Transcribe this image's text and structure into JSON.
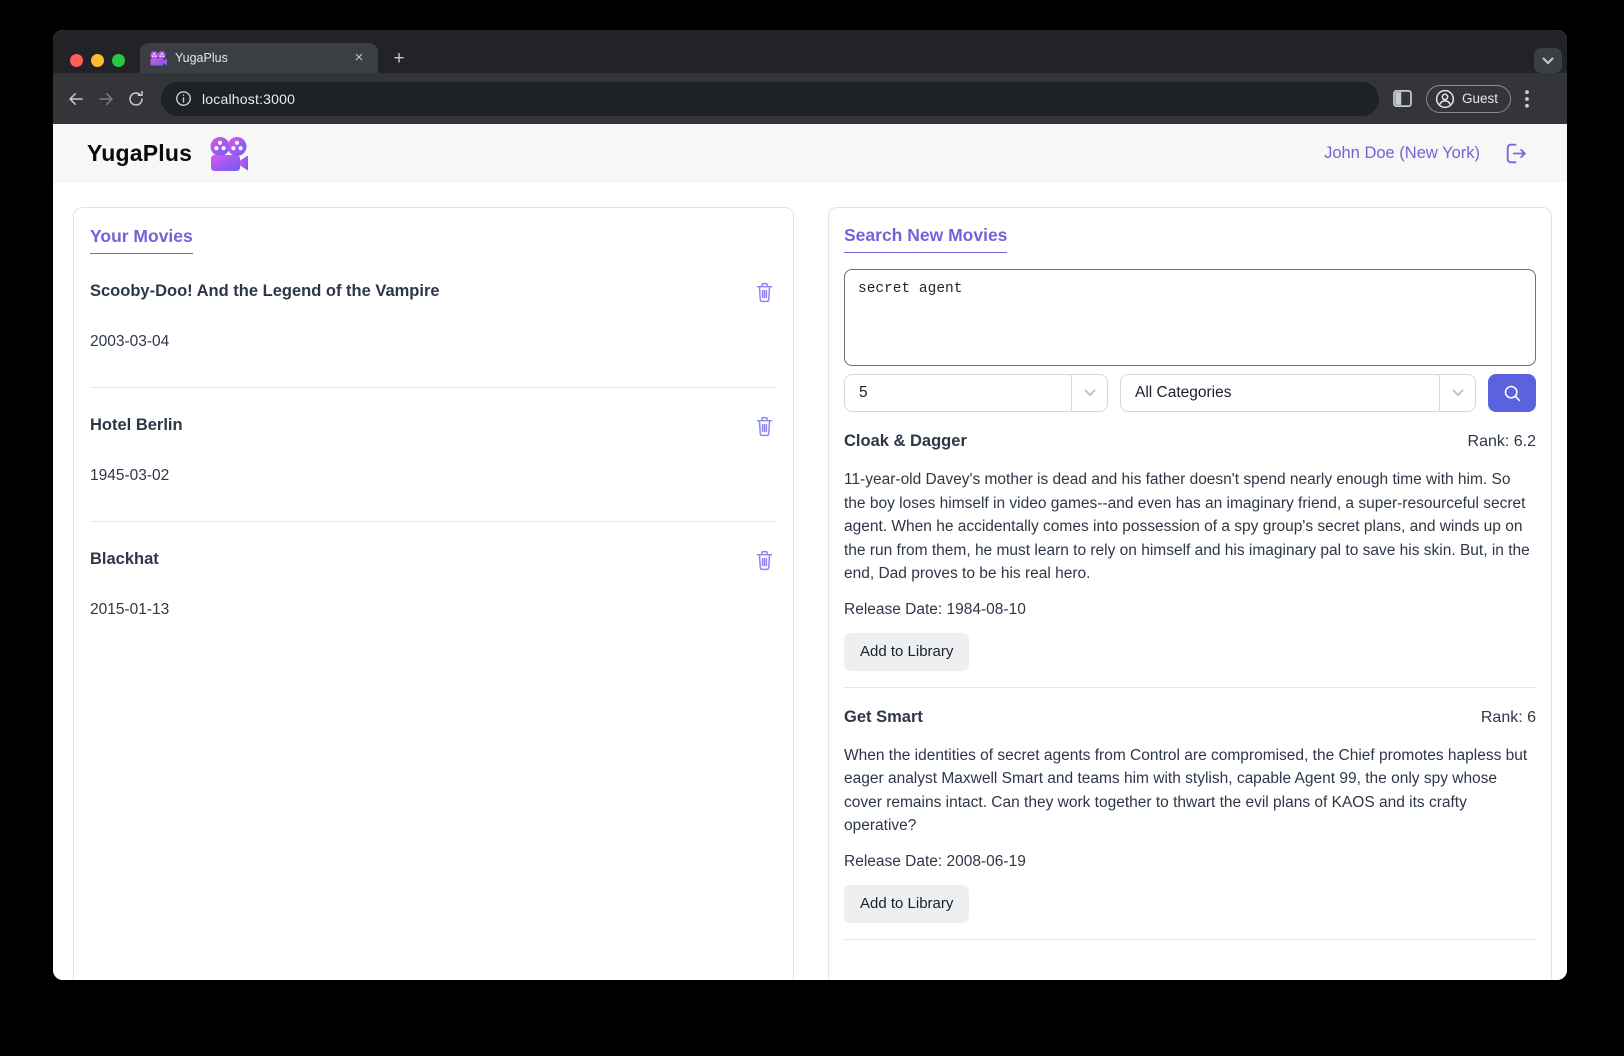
{
  "browser": {
    "tab_title": "YugaPlus",
    "close_glyph": "×",
    "newtab_glyph": "+",
    "url": "localhost:3000",
    "guest_label": "Guest"
  },
  "header": {
    "brand": "YugaPlus",
    "user": "John Doe (New York)"
  },
  "library": {
    "heading": "Your Movies",
    "movies": [
      {
        "title": "Scooby-Doo! And the Legend of the Vampire",
        "date": "2003-03-04"
      },
      {
        "title": "Hotel Berlin",
        "date": "1945-03-02"
      },
      {
        "title": "Blackhat",
        "date": "2015-01-13"
      }
    ]
  },
  "search": {
    "heading": "Search New Movies",
    "query": "secret agent",
    "limit_value": "5",
    "category_value": "All Categories",
    "results": [
      {
        "title": "Cloak & Dagger",
        "rank": "Rank: 6.2",
        "description": "11-year-old Davey's mother is dead and his father doesn't spend nearly enough time with him. So the boy loses himself in video games--and even has an imaginary friend, a super-resourceful secret agent. When he accidentally comes into possession of a spy group's secret plans, and winds up on the run from them, he must learn to rely on himself and his imaginary pal to save his skin. But, in the end, Dad proves to be his real hero.",
        "release": "Release Date: 1984-08-10",
        "action": "Add to Library"
      },
      {
        "title": "Get Smart",
        "rank": "Rank: 6",
        "description": "When the identities of secret agents from Control are compromised, the Chief promotes hapless but eager analyst Maxwell Smart and teams him with stylish, capable Agent 99, the only spy whose cover remains intact. Can they work together to thwart the evil plans of KAOS and its crafty operative?",
        "release": "Release Date: 2008-06-19",
        "action": "Add to Library"
      }
    ]
  },
  "colors": {
    "accent": "#7064d8",
    "search_button": "#5a62de",
    "trash_icon": "#8f85ee",
    "traffic_close": "#ff5f57",
    "traffic_minimize": "#febc2e",
    "traffic_zoom": "#28c840"
  }
}
